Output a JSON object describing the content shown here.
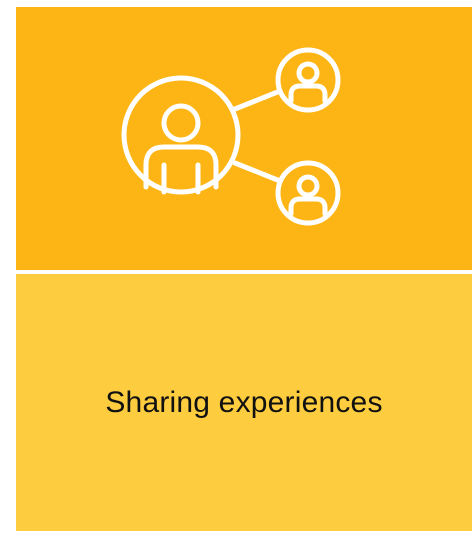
{
  "tile": {
    "icon": "share-network-users-icon",
    "caption": "Sharing experiences",
    "top_color": "#FDB515",
    "bottom_color": "#FDCC3F",
    "icon_color": "#FFFFFF"
  }
}
